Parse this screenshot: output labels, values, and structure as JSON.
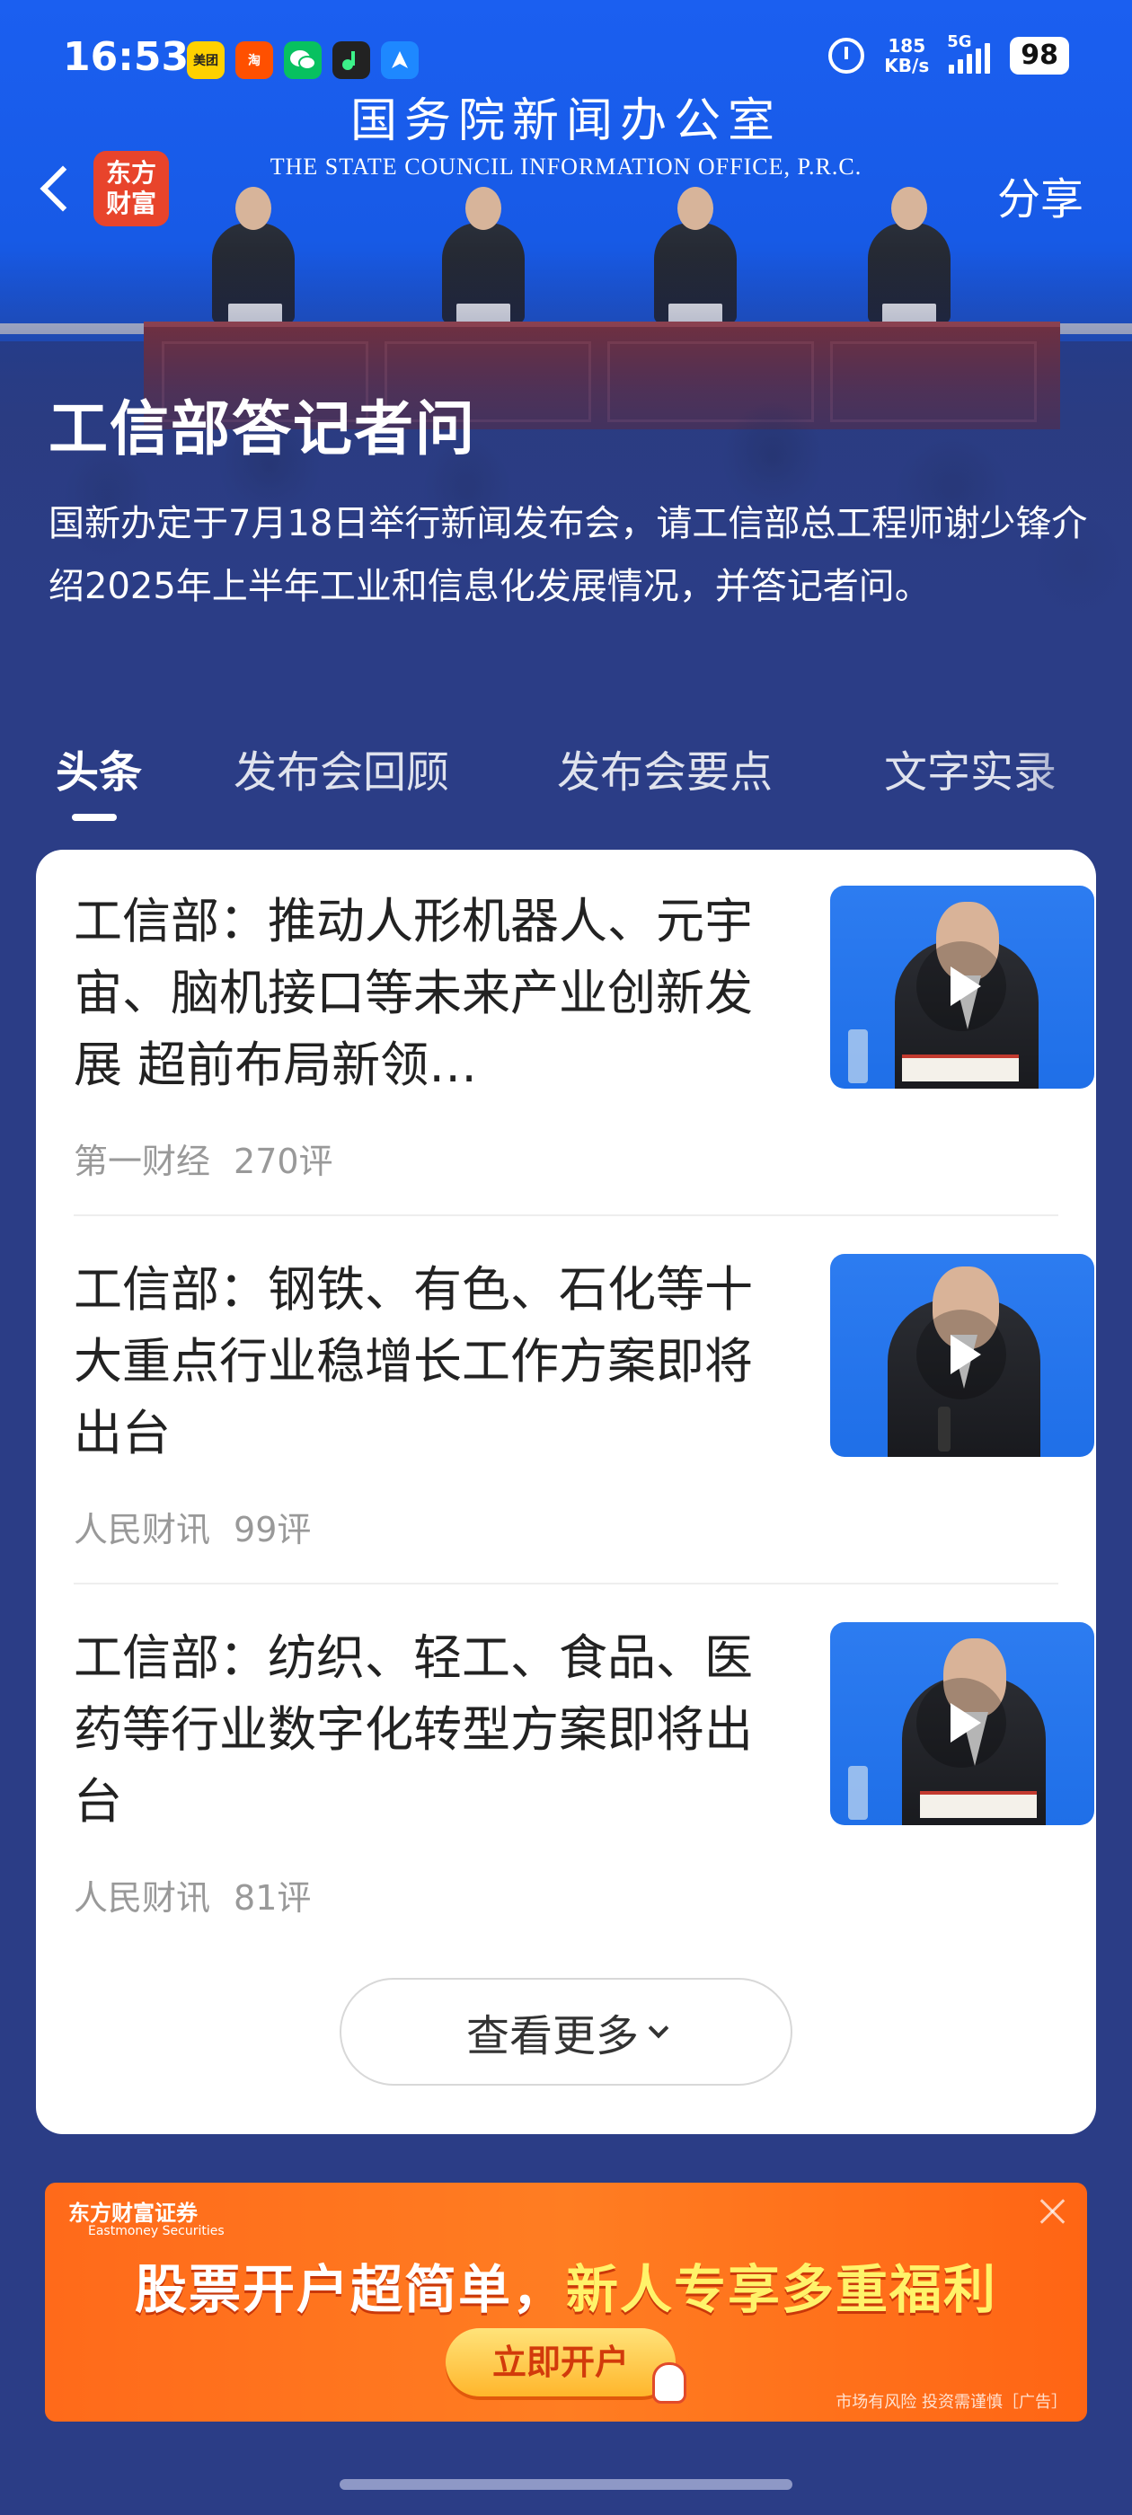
{
  "status_bar": {
    "time": "16:53",
    "app_icons": [
      {
        "name": "meituan-icon",
        "label": "美团",
        "color": "#ffd100"
      },
      {
        "name": "taobao-icon",
        "label": "淘",
        "color": "#ff5000"
      },
      {
        "name": "wechat-icon",
        "label": "",
        "color": "#07c160"
      },
      {
        "name": "music-app-icon",
        "label": "",
        "color": "#222222"
      },
      {
        "name": "navigation-app-icon",
        "label": "",
        "color": "#1e88ff"
      }
    ],
    "net_speed_value": "185",
    "net_speed_unit": "KB/s",
    "network": "5G",
    "battery": "98"
  },
  "nav": {
    "logo_line1": "东方",
    "logo_line2": "财富",
    "share_label": "分享"
  },
  "hero": {
    "sign_cn": "国务院新闻办公室",
    "sign_en": "THE STATE COUNCIL INFORMATION OFFICE, P.R.C.",
    "title": "工信部答记者问",
    "description": "国新办定于7月18日举行新闻发布会，请工信部总工程师谢少锋介绍2025年上半年工业和信息化发展情况，并答记者问。"
  },
  "tabs": [
    {
      "label": "头条",
      "active": true
    },
    {
      "label": "发布会回顾",
      "active": false
    },
    {
      "label": "发布会要点",
      "active": false
    },
    {
      "label": "文字实录",
      "active": false
    }
  ],
  "articles": [
    {
      "title": "工信部：推动人形机器人、元宇宙、脑机接口等未来产业创新发展 超前布局新领…",
      "source": "第一财经",
      "comments": "270评",
      "plate_name": "谢少锋"
    },
    {
      "title": "工信部：钢铁、有色、石化等十大重点行业稳增长工作方案即将出台",
      "source": "人民财讯",
      "comments": "99评",
      "plate_name": ""
    },
    {
      "title": "工信部：纺织、轻工、食品、医药等行业数字化转型方案即将出台",
      "source": "人民财讯",
      "comments": "81评",
      "plate_name": "谢 存"
    }
  ],
  "more_button": "查看更多",
  "ad": {
    "brand": "东方财富证券",
    "brand_en": "Eastmoney Securities",
    "headline_part1": "股票开户超简单，",
    "headline_part2": "新人专享多重福利",
    "cta": "立即开户",
    "disclaimer": "市场有风险 投资需谨慎［广告］"
  },
  "colors": {
    "page_bg": "#2b3d86",
    "accent_red": "#e8442b",
    "ad_orange": "#ff6a1a"
  }
}
